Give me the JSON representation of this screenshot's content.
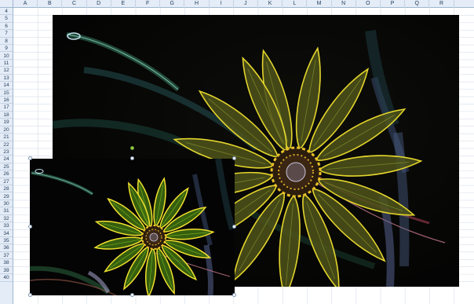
{
  "spreadsheet": {
    "columns": [
      "A",
      "B",
      "C",
      "D",
      "E",
      "F",
      "G",
      "H",
      "I",
      "J",
      "K",
      "L",
      "M",
      "N",
      "O",
      "P",
      "Q",
      "R"
    ],
    "rows": [
      "4",
      "5",
      "6",
      "7",
      "8",
      "9",
      "10",
      "11",
      "12",
      "13",
      "14",
      "15",
      "16",
      "17",
      "18",
      "19",
      "20",
      "21",
      "22",
      "23",
      "24",
      "25",
      "26",
      "27",
      "28",
      "29",
      "30",
      "31",
      "32",
      "33",
      "34",
      "35",
      "36",
      "37",
      "38",
      "39",
      "40"
    ]
  },
  "images": {
    "large": {
      "subject": "flower-glowing-edges",
      "colors": {
        "outline": "#e0d12a",
        "petal": "#52561b",
        "center": "#3b2410",
        "background": "#050505"
      }
    },
    "small": {
      "subject": "flower-glowing-edges",
      "state": "selected",
      "colors": {
        "outline": "#f0e12c",
        "petal": "#4d7a12",
        "center": "#3b2410",
        "background": "#050505"
      }
    }
  },
  "colors": {
    "header_bg": "#e4ecf7",
    "header_text": "#27415f",
    "gridline": "#d6dde7",
    "selection_handle": "#7d92ad",
    "rotation_handle": "#9ad14b"
  }
}
